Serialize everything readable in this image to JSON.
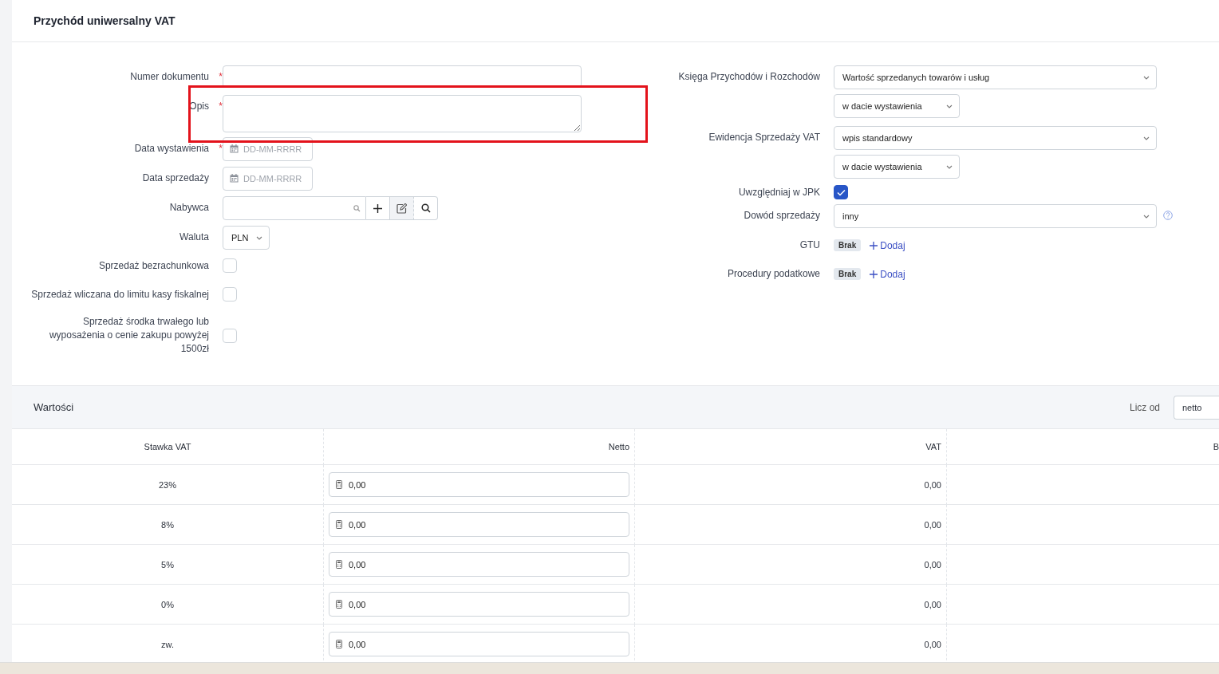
{
  "title": "Przychód uniwersalny VAT",
  "annotation": {
    "visible": true
  },
  "left_fields": [
    {
      "kind": "text",
      "label": "Numer dokumentu",
      "required_mark": "*"
    },
    {
      "kind": "textarea",
      "label": "Opis",
      "required_mark": "*"
    },
    {
      "kind": "date",
      "label": "Data wystawienia",
      "required_mark": "*",
      "placeholder": "DD-MM-RRRR"
    },
    {
      "kind": "date",
      "label": "Data sprzedaży",
      "placeholder": "DD-MM-RRRR"
    },
    {
      "kind": "lookup",
      "label": "Nabywca"
    },
    {
      "kind": "select",
      "label": "Waluta",
      "value": "PLN"
    },
    {
      "kind": "checkbox",
      "label": "Sprzedaż bezrachunkowa",
      "checked": false
    },
    {
      "kind": "checkbox",
      "label": "Sprzedaż wliczana do limitu kasy fiskalnej",
      "checked": false
    },
    {
      "kind": "checkbox",
      "label": "Sprzedaż środka trwałego lub wyposażenia o cenie zakupu powyżej 1500zł",
      "checked": false
    }
  ],
  "right_fields": [
    {
      "kind": "select",
      "label": "Księga Przychodów i Rozchodów",
      "values": [
        "Wartość sprzedanych towarów i usług",
        "w dacie wystawienia"
      ]
    },
    {
      "kind": "select",
      "label": "Ewidencja Sprzedaży VAT",
      "values": [
        "wpis standardowy",
        "w dacie wystawienia"
      ]
    },
    {
      "kind": "checkbox",
      "label": "Uwzględniaj w JPK",
      "checked": true
    },
    {
      "kind": "select",
      "label": "Dowód sprzedaży",
      "values": [
        "inny"
      ],
      "help": true
    },
    {
      "kind": "tags",
      "label": "GTU",
      "badge": "Brak",
      "add": "Dodaj"
    },
    {
      "kind": "tags",
      "label": "Procedury podatkowe",
      "badge": "Brak",
      "add": "Dodaj"
    }
  ],
  "values": {
    "title": "Wartości",
    "calc_label": "Licz od",
    "calc_value": "netto",
    "columns": [
      "Stawka VAT",
      "Netto",
      "VAT",
      "B"
    ],
    "rows": [
      {
        "rate": "23%",
        "net": "0,00",
        "vat": "0,00"
      },
      {
        "rate": "8%",
        "net": "0,00",
        "vat": "0,00"
      },
      {
        "rate": "5%",
        "net": "0,00",
        "vat": "0,00"
      },
      {
        "rate": "0%",
        "net": "0,00",
        "vat": "0,00"
      },
      {
        "rate": "zw.",
        "net": "0,00",
        "vat": "0,00"
      }
    ]
  }
}
